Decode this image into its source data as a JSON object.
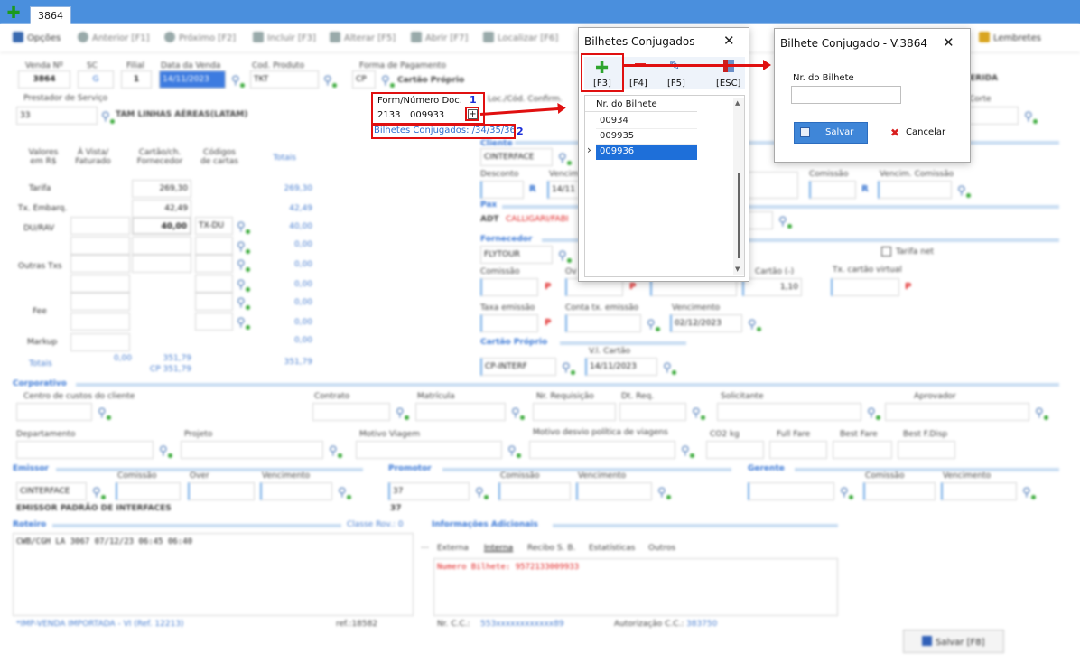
{
  "tab": {
    "label": "3864"
  },
  "toolbar": [
    {
      "label": "Opções"
    },
    {
      "label": "Anterior [F1]"
    },
    {
      "label": "Próximo [F2]"
    },
    {
      "label": "Incluir [F3]"
    },
    {
      "label": "Alterar [F5]"
    },
    {
      "label": "Abrir [F7]"
    },
    {
      "label": "Localizar [F6]"
    },
    {
      "label": "Lembretes"
    }
  ],
  "header": {
    "venda_label": "Venda Nº",
    "venda": "3864",
    "sc_label": "SC",
    "sc": "G",
    "filial_label": "Filial",
    "filial": "1",
    "data_label": "Data da Venda",
    "data": "14/11/2023",
    "produto_label": "Cod. Produto",
    "produto": "TKT",
    "forma_label": "Forma de Pagamento",
    "forma_code": "CP",
    "forma": "Cartão Próprio",
    "status_right": "FERIDA",
    "prestador_label": "Prestador de Serviço",
    "prestador_code": "33",
    "prestador": "TAM LINHAS AÉREAS(LATAM)",
    "loc_label": "Loc./Cód. Confirm.",
    "corte_label": "Corte"
  },
  "form": {
    "label": "Form/Número Doc.",
    "code": "2133",
    "number": "009933",
    "plus": "+",
    "conjugados": "Bilhetes Conjugados: /34/35/36"
  },
  "annotations": {
    "n1": "1",
    "n2": "2"
  },
  "values_table": {
    "headers": [
      "Valores em R$",
      "À Vista/ Faturado",
      "Cartão/ch. Fornecedor",
      "Códigos de cartas",
      "Totais"
    ],
    "rows": [
      {
        "label": "Tarifa",
        "card": "269,30",
        "total": "269,30"
      },
      {
        "label": "Tx. Embarq.",
        "card": "42,49",
        "total": "42,49"
      },
      {
        "label": "DU/RAV",
        "card": "40,00",
        "code": "TX-DU",
        "total": "40,00"
      },
      {
        "label": "",
        "total": "0,00"
      },
      {
        "label": "Outras Txs",
        "total": "0,00"
      },
      {
        "label": "",
        "total": "0,00"
      },
      {
        "label": "Fee",
        "total": "0,00"
      },
      {
        "label": "",
        "total": "0,00"
      },
      {
        "label": "Markup",
        "total": "0,00"
      }
    ],
    "totais_label": "Totais",
    "totais_vista": "0,00",
    "totais_card": "351,79",
    "totais_cp": "CP 351,79",
    "totais_total": "351,79"
  },
  "cliente": {
    "section": "Cliente",
    "name": "CINTERFACE",
    "desconto_label": "Desconto",
    "vencim_label": "Vencim.",
    "vencim": "14/11",
    "comissao_label": "Comissão",
    "vencim_comissao_label": "Vencim. Comissão",
    "r": "R"
  },
  "pax": {
    "section": "Pax",
    "code": "ADT",
    "name": "CALLIGARI/FABI"
  },
  "fornecedor": {
    "section": "Fornecedor",
    "name": "FLYTOUR",
    "tarifa_net": "Tarifa net",
    "comissao_label": "Comissão",
    "over_label": "Ov",
    "cartao_label": "Cartão (-)",
    "cartao": "1,10",
    "tx_virtual_label": "Tx. cartão virtual",
    "taxa_label": "Taxa emissão",
    "conta_label": "Conta tx. emissão",
    "venc_label": "Vencimento",
    "venc": "02/12/2023",
    "p": "P"
  },
  "cartao_proprio": {
    "section": "Cartão Próprio",
    "vl_label": "V.l. Cartão",
    "code": "CP-INTERF",
    "data": "14/11/2023"
  },
  "corporativo": {
    "section": "Corporativo",
    "labels": [
      "Centro de custos do cliente",
      "Contrato",
      "Matrícula",
      "Nr. Requisição",
      "Dt. Req.",
      "Solicitante",
      "Aprovador"
    ],
    "labels2": [
      "Departamento",
      "Projeto",
      "Motivo Viagem",
      "Motivo desvio política de viagens",
      "CO2 kg",
      "Full Fare",
      "Best Fare",
      "Best F.Disp"
    ]
  },
  "emissor": {
    "section": "Emissor",
    "comissao": "Comissão",
    "over": "Over",
    "venc": "Vencimento",
    "name": "CINTERFACE",
    "padrao": "EMISSOR PADRÃO DE INTERFACES"
  },
  "promotor": {
    "section": "Promotor",
    "comissao": "Comissão",
    "venc": "Vencimento",
    "code": "37",
    "sub": "37"
  },
  "gerente": {
    "section": "Gerente",
    "comissao": "Comissão",
    "venc": "Vencimento"
  },
  "roteiro": {
    "section": "Roteiro",
    "classe": "Classe Rov.: 0",
    "text": "CWB/CGH LA 3067 07/12/23 06:45 06:40"
  },
  "info": {
    "section": "Informações Adicionais",
    "tabs": [
      "Externa",
      "Interna",
      "Recibo S. B.",
      "Estatísticas",
      "Outros"
    ],
    "text": "Numero Bilhete: 9572133009933"
  },
  "footer": {
    "imp": "*IMP-VENDA IMPORTADA - VI (Ref. 12213)",
    "ref": "ref.:18582",
    "nrcc_label": "Nr. C.C.:",
    "nrcc": "553xxxxxxxxxxxx89",
    "aut_label": "Autorização C.C.:",
    "aut": "383750",
    "save": "Salvar [F8]"
  },
  "dialog1": {
    "title": "Bilhetes Conjugados",
    "close": "✕",
    "keys": [
      "[F3]",
      "[F4]",
      "[F5]",
      "[ESC]"
    ],
    "col": "Nr. do Bilhete",
    "rows": [
      "00934",
      "009935",
      "009936"
    ]
  },
  "dialog2": {
    "title": "Bilhete Conjugado - V.3864",
    "close": "✕",
    "field_label": "Nr. do Bilhete",
    "save": "Salvar",
    "cancel": "Cancelar"
  },
  "colors": {
    "accent": "#4a8fdd",
    "annotation": "#e01010",
    "selected_row": "#1e6fd9"
  }
}
